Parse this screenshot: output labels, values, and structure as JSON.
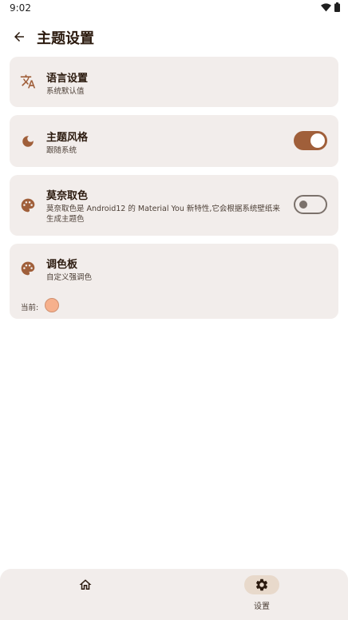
{
  "status_bar": {
    "time": "9:02"
  },
  "header": {
    "title": "主题设置"
  },
  "settings": {
    "language": {
      "title": "语言设置",
      "subtitle": "系统默认值"
    },
    "theme_style": {
      "title": "主题风格",
      "subtitle": "跟随系统",
      "enabled": true
    },
    "monet": {
      "title": "莫奈取色",
      "subtitle": "莫奈取色是 Android12 的 Material You 新特性,它会根据系统壁纸来生成主题色",
      "enabled": false
    },
    "palette": {
      "title": "调色板",
      "subtitle": "自定义强调色",
      "current_label": "当前:",
      "current_color": "#f6b08c"
    }
  },
  "bottom_nav": {
    "items": [
      {
        "label": "",
        "icon": "home-icon",
        "active": false
      },
      {
        "label": "设置",
        "icon": "gear-icon",
        "active": true
      }
    ]
  },
  "colors": {
    "accent": "#a05f3a",
    "card_bg": "#f2edeb",
    "icon": "#a05f3a"
  }
}
